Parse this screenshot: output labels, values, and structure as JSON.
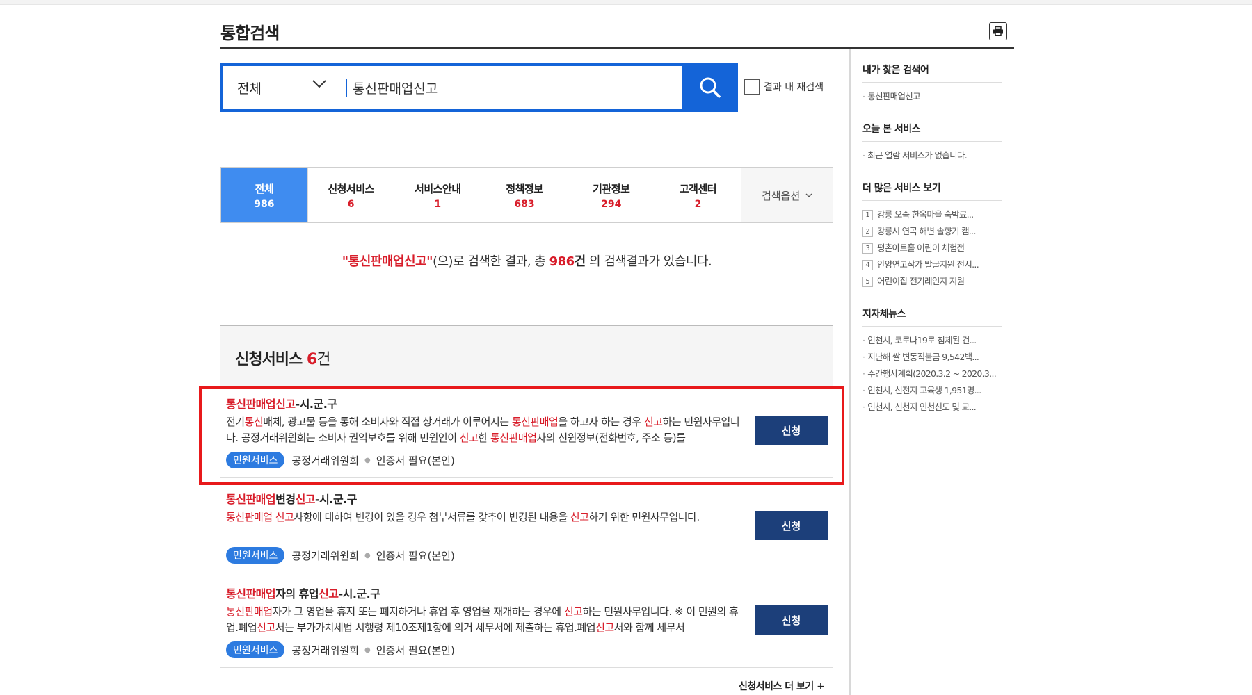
{
  "page": {
    "title": "통합검색"
  },
  "search": {
    "scope": "전체",
    "query": "통신판매업신고",
    "research_label": "결과 내 재검색"
  },
  "tabs": [
    {
      "label": "전체",
      "count": "986"
    },
    {
      "label": "신청서비스",
      "count": "6"
    },
    {
      "label": "서비스안내",
      "count": "1"
    },
    {
      "label": "정책정보",
      "count": "683"
    },
    {
      "label": "기관정보",
      "count": "294"
    },
    {
      "label": "고객센터",
      "count": "2"
    }
  ],
  "search_options_label": "검색옵션",
  "summary": {
    "keyword": "\"통신판매업신고\"",
    "part1": "(으)로 검색한 결과, 총 ",
    "total": "986",
    "unit": "건",
    "part2": " 의 검색결과가 있습니다."
  },
  "section": {
    "title": "신청서비스 ",
    "count": "6",
    "unit": "건"
  },
  "results": [
    {
      "title": [
        [
          "통신판매업신고",
          true
        ],
        [
          "-시.군.구",
          false
        ]
      ],
      "desc": [
        [
          "전기",
          false
        ],
        [
          "통신",
          true
        ],
        [
          "매체, 광고물 등을 통해 소비자와 직접 상거래가 이루어지는 ",
          false
        ],
        [
          "통신판매업",
          true
        ],
        [
          "을 하고자 하는 경우 ",
          false
        ],
        [
          "신고",
          true
        ],
        [
          "하는 민원사무입니다. 공정거래위원회는 소비자 권익보호를 위해 민원인이 ",
          false
        ],
        [
          "신고",
          true
        ],
        [
          "한 ",
          false
        ],
        [
          "통신판매업",
          true
        ],
        [
          "자의 신원정보(전화번호, 주소 등)를",
          false
        ]
      ],
      "badge": "민원서비스",
      "org": "공정거래위원회",
      "cert": "인증서 필요(본인)",
      "button": "신청"
    },
    {
      "title": [
        [
          "통신판매업",
          true
        ],
        [
          "변경",
          false
        ],
        [
          "신고",
          true
        ],
        [
          "-시.군.구",
          false
        ]
      ],
      "desc": [
        [
          "통신판매업",
          true
        ],
        [
          " ",
          false
        ],
        [
          "신고",
          true
        ],
        [
          "사항에 대하여 변경이 있을 경우 첨부서류를 갖추어 변경된 내용을 ",
          false
        ],
        [
          "신고",
          true
        ],
        [
          "하기 위한 민원사무입니다.",
          false
        ]
      ],
      "badge": "민원서비스",
      "org": "공정거래위원회",
      "cert": "인증서 필요(본인)",
      "button": "신청"
    },
    {
      "title": [
        [
          "통신판매업",
          true
        ],
        [
          "자의 휴업",
          false
        ],
        [
          "신고",
          true
        ],
        [
          "-시.군.구",
          false
        ]
      ],
      "desc": [
        [
          "통신판매업",
          true
        ],
        [
          "자가 그 영업을 휴지 또는 폐지하거나 휴업 후 영업을 재개하는 경우에 ",
          false
        ],
        [
          "신고",
          true
        ],
        [
          "하는 민원사무입니다. ※ 이 민원의 휴업.폐업",
          false
        ],
        [
          "신고",
          true
        ],
        [
          "서는 부가가치세법 시행령 제10조제1항에 의거 세무서에 제출하는 휴업.폐업",
          false
        ],
        [
          "신고",
          true
        ],
        [
          "서와 함께 세무서",
          false
        ]
      ],
      "badge": "민원서비스",
      "org": "공정거래위원회",
      "cert": "인증서 필요(본인)",
      "button": "신청"
    }
  ],
  "more_link": "신청서비스 더 보기  +",
  "sidebar": {
    "my_searches": {
      "title": "내가 찾은 검색어",
      "items": [
        "통신판매업신고"
      ]
    },
    "today_services": {
      "title": "오늘 본 서비스",
      "items": [
        "최근 열람 서비스가 없습니다."
      ]
    },
    "more_services": {
      "title": "더 많은 서비스 보기",
      "items": [
        "강릉 오죽 한옥마을 숙박료...",
        "강릉시 연곡 해변 솔향기 캠...",
        "평촌아트홀 어린이 체험전",
        "안양연고작가 발굴지원 전시...",
        "어린이집 전기레인지 지원"
      ]
    },
    "local_news": {
      "title": "지자체뉴스",
      "items": [
        "인천시, 코로나19로 침체된 건...",
        "지난해 쌀 변동직불금 9,542백...",
        "주간행사계획(2020.3.2 ~ 2020.3...",
        "인천시, 신전지 교육생 1,951명...",
        "인천시, 신천지 인천신도 및 교..."
      ]
    }
  }
}
